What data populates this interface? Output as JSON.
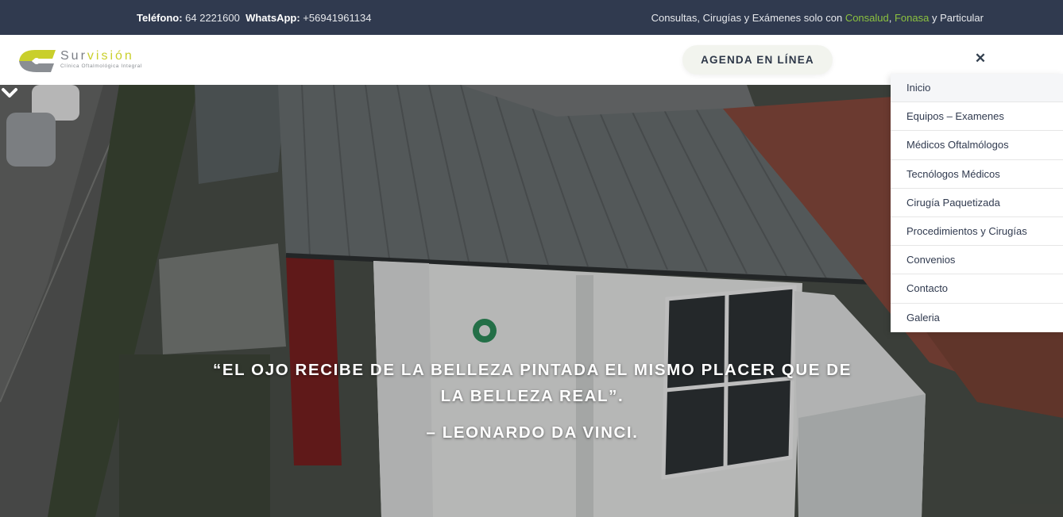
{
  "topbar": {
    "phone_label": "Teléfono:",
    "phone_value": " 64 2221600",
    "whatsapp_label": "WhatsApp:",
    "whatsapp_value": " +56941961134",
    "right_prefix": "Consultas, Cirugías y Exámenes solo con ",
    "consalud": "Consalud",
    "comma": ", ",
    "fonasa": "Fonasa",
    "right_suffix": " y Particular"
  },
  "header": {
    "logo_part1": "Sur",
    "logo_part2": "visión",
    "logo_subtitle": "Clínica Oftalmológica Integral",
    "agenda_label": "AGENDA EN LÍNEA",
    "close_symbol": "✕"
  },
  "hero": {
    "quote": "“EL OJO RECIBE DE LA BELLEZA PINTADA EL MISMO PLACER QUE DE LA BELLEZA REAL”.",
    "author": "– LEONARDO DA VINCI."
  },
  "menu": {
    "items": [
      {
        "label": "Inicio"
      },
      {
        "label": "Equipos – Examenes"
      },
      {
        "label": "Médicos Oftalmólogos"
      },
      {
        "label": "Tecnólogos Médicos"
      },
      {
        "label": "Cirugía Paquetizada"
      },
      {
        "label": "Procedimientos y Cirugías"
      },
      {
        "label": "Convenios"
      },
      {
        "label": "Contacto"
      },
      {
        "label": "Galeria"
      }
    ]
  },
  "colors": {
    "topbar_bg": "#303a4f",
    "accent_green": "#8cc23f",
    "logo_yellow": "#c9cf2b"
  },
  "icons": {
    "close": "close-icon",
    "scroll_down": "chevron-down-icon",
    "logo": "survision-logo-icon"
  }
}
